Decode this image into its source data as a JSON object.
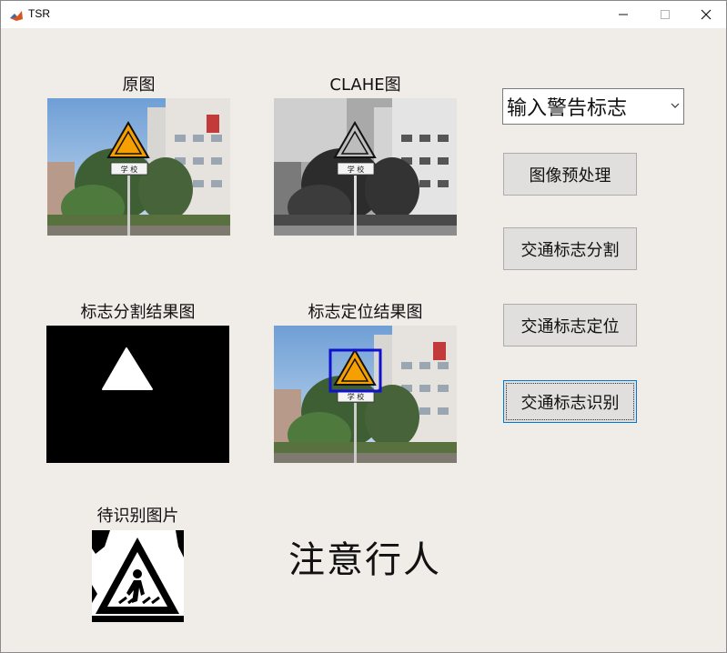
{
  "window": {
    "title": "TSR"
  },
  "panels": {
    "original_title": "原图",
    "clahe_title": "CLAHE图",
    "segmentation_title": "标志分割结果图",
    "localization_title": "标志定位结果图",
    "recognize_title": "待识别图片",
    "sign_plate_text": "学 校"
  },
  "controls": {
    "select_value": "输入警告标志",
    "preprocess_label": "图像预处理",
    "segment_label": "交通标志分割",
    "locate_label": "交通标志定位",
    "recognize_label": "交通标志识别"
  },
  "result": {
    "text": "注意行人"
  },
  "colors": {
    "accent": "#0078d7",
    "box": "#1010d0",
    "sign": "#f5a000"
  }
}
